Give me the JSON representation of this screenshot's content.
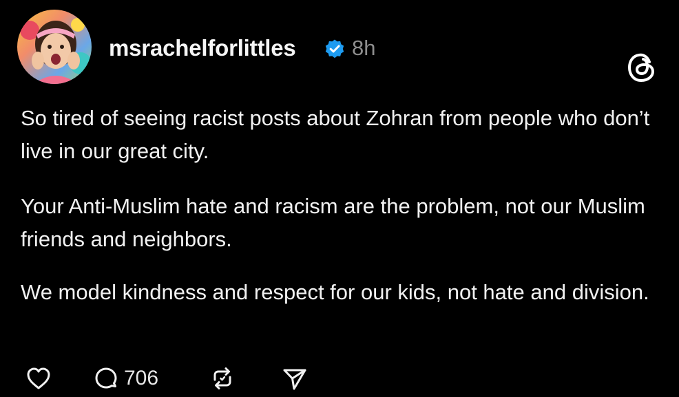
{
  "post": {
    "username": "msrachelforlittles",
    "timestamp": "8h",
    "paragraphs": [
      "So tired of seeing racist posts about Zohran from people who don’t live in our great city.",
      "Your Anti-Muslim hate and racism are the problem, not our Muslim friends and neighbors.",
      "We model kindness and respect for our kids, not hate and division."
    ],
    "reply_count": "706"
  },
  "icons": {
    "verified": "verified-badge-icon",
    "platform": "threads-logo-icon",
    "like": "heart-icon",
    "reply": "comment-icon",
    "repost": "repost-icon",
    "share": "share-send-icon"
  },
  "colors": {
    "background": "#000000",
    "text": "#f1f1f1",
    "muted": "#8e8e8e",
    "verified": "#1d9bf0"
  }
}
